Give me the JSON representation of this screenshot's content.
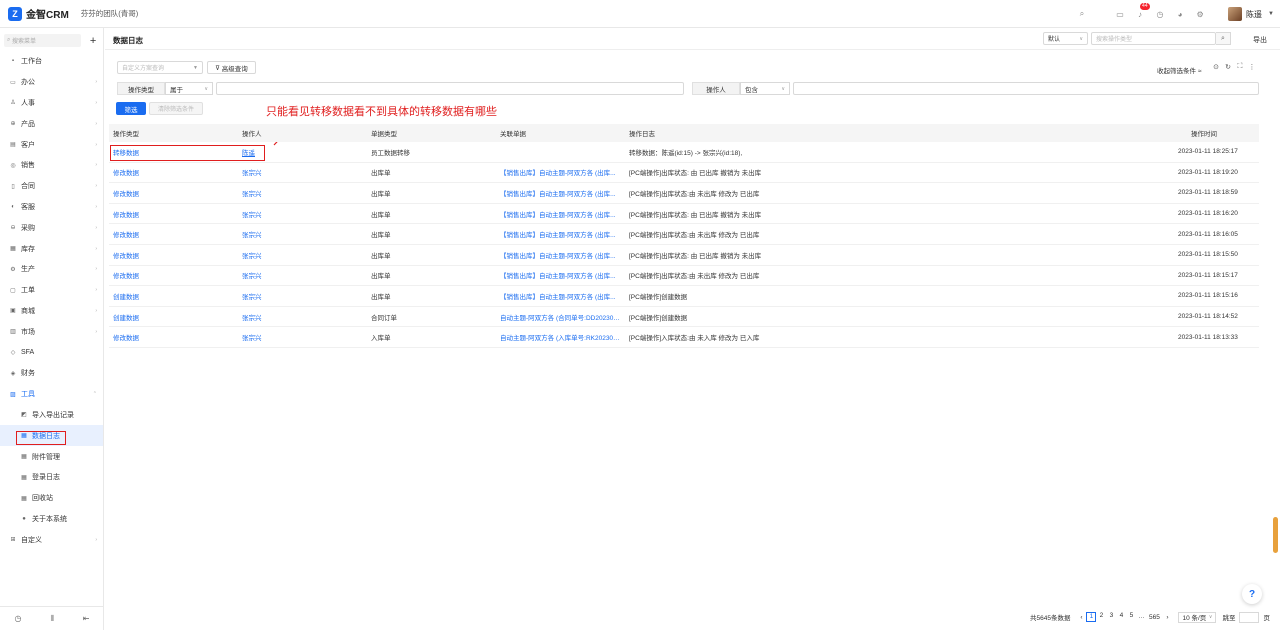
{
  "app": {
    "logo_mark": "Z",
    "name": "金智CRM",
    "team": "芬芬的团队(青哥)"
  },
  "topbar": {
    "icons": [
      "search-icon",
      "box-icon",
      "bell-icon",
      "clock-icon",
      "chart-icon",
      "settings-icon"
    ],
    "badge": "44",
    "user_name": "陈遥"
  },
  "sidebar": {
    "search_placeholder": "搜索菜单",
    "items": [
      {
        "label": "工作台",
        "icon": "▪"
      },
      {
        "label": "办公",
        "icon": "▭"
      },
      {
        "label": "人事",
        "icon": "♙"
      },
      {
        "label": "产品",
        "icon": "⊕"
      },
      {
        "label": "客户",
        "icon": "▤"
      },
      {
        "label": "销售",
        "icon": "◎"
      },
      {
        "label": "合同",
        "icon": "▯"
      },
      {
        "label": "客服",
        "icon": "◐"
      },
      {
        "label": "采购",
        "icon": "⊖"
      },
      {
        "label": "库存",
        "icon": "▦"
      },
      {
        "label": "生产",
        "icon": "⚙"
      },
      {
        "label": "工单",
        "icon": "▢"
      },
      {
        "label": "商城",
        "icon": "▣"
      },
      {
        "label": "市场",
        "icon": "▥"
      },
      {
        "label": "SFA",
        "icon": "◇"
      },
      {
        "label": "财务",
        "icon": "◈"
      },
      {
        "label": "工具",
        "icon": "▨"
      }
    ],
    "sub_items": [
      {
        "label": "导入导出记录",
        "icon": "◩"
      },
      {
        "label": "数据日志",
        "icon": "▦"
      },
      {
        "label": "附件管理",
        "icon": "▦"
      },
      {
        "label": "登录日志",
        "icon": "▦"
      },
      {
        "label": "回收站",
        "icon": "▦"
      },
      {
        "label": "关于本系统",
        "icon": "●"
      }
    ],
    "last_item": {
      "label": "自定义",
      "icon": "⊞"
    }
  },
  "header": {
    "title": "数据日志",
    "view_select": "默认",
    "search_placeholder": "搜索操作类型",
    "export_label": "导出"
  },
  "filters": {
    "scheme_placeholder": "自定义方案查询",
    "advanced_label": "高级查询",
    "collapse_label": "收起筛选条件",
    "cond1_label": "操作类型",
    "cond1_op": "属于",
    "cond2_label": "操作人",
    "cond2_op": "包含",
    "filter_button": "筛选",
    "clear_button": "清除筛选条件"
  },
  "annotation": "只能看见转移数据看不到具体的转移数据有哪些",
  "table": {
    "headers": [
      "操作类型",
      "操作人",
      "单据类型",
      "关联单据",
      "操作日志",
      "操作时间"
    ],
    "rows": [
      {
        "type": "转移数据",
        "user": "陈遥",
        "doc_type": "员工数据转移",
        "related": "",
        "log": "转移数据：陈遥(id:15) -> 张宗兴(id:18),",
        "time": "2023-01-11 18:25:17"
      },
      {
        "type": "修改数据",
        "user": "张宗兴",
        "doc_type": "出库单",
        "related": "【销售出库】自动主题-阿双方各 (出库...",
        "log": "[PC端操作]出库状态: 由 已出库 撤销为 未出库",
        "time": "2023-01-11 18:19:20"
      },
      {
        "type": "修改数据",
        "user": "张宗兴",
        "doc_type": "出库单",
        "related": "【销售出库】自动主题-阿双方各 (出库...",
        "log": "[PC端操作]出库状态:由 未出库 修改为 已出库",
        "time": "2023-01-11 18:18:59"
      },
      {
        "type": "修改数据",
        "user": "张宗兴",
        "doc_type": "出库单",
        "related": "【销售出库】自动主题-阿双方各 (出库...",
        "log": "[PC端操作]出库状态: 由 已出库 撤销为 未出库",
        "time": "2023-01-11 18:16:20"
      },
      {
        "type": "修改数据",
        "user": "张宗兴",
        "doc_type": "出库单",
        "related": "【销售出库】自动主题-阿双方各 (出库...",
        "log": "[PC端操作]出库状态:由 未出库 修改为 已出库",
        "time": "2023-01-11 18:16:05"
      },
      {
        "type": "修改数据",
        "user": "张宗兴",
        "doc_type": "出库单",
        "related": "【销售出库】自动主题-阿双方各 (出库...",
        "log": "[PC端操作]出库状态: 由 已出库 撤销为 未出库",
        "time": "2023-01-11 18:15:50"
      },
      {
        "type": "修改数据",
        "user": "张宗兴",
        "doc_type": "出库单",
        "related": "【销售出库】自动主题-阿双方各 (出库...",
        "log": "[PC端操作]出库状态:由 未出库 修改为 已出库",
        "time": "2023-01-11 18:15:17"
      },
      {
        "type": "创建数据",
        "user": "张宗兴",
        "doc_type": "出库单",
        "related": "【销售出库】自动主题-阿双方各 (出库...",
        "log": "[PC端操作]创建数据",
        "time": "2023-01-11 18:15:16"
      },
      {
        "type": "创建数据",
        "user": "张宗兴",
        "doc_type": "合同订单",
        "related": "自动主题-阿双方各 (合同单号:DD202301...",
        "log": "[PC端操作]创建数据",
        "time": "2023-01-11 18:14:52"
      },
      {
        "type": "修改数据",
        "user": "张宗兴",
        "doc_type": "入库单",
        "related": "自动主题-阿双方各 (入库单号:RK202301...",
        "log": "[PC端操作]入库状态:由 未入库 修改为 已入库",
        "time": "2023-01-11 18:13:33"
      }
    ]
  },
  "pagination": {
    "total": "共5645条数据",
    "pages": [
      "1",
      "2",
      "3",
      "4",
      "5"
    ],
    "ellipsis": "···",
    "last_page": "565",
    "page_size": "10 条/页",
    "jump_label": "跳至",
    "page_suffix": "页"
  },
  "colors": {
    "accent": "#1a6cf0",
    "annotation": "#e01e1e"
  }
}
